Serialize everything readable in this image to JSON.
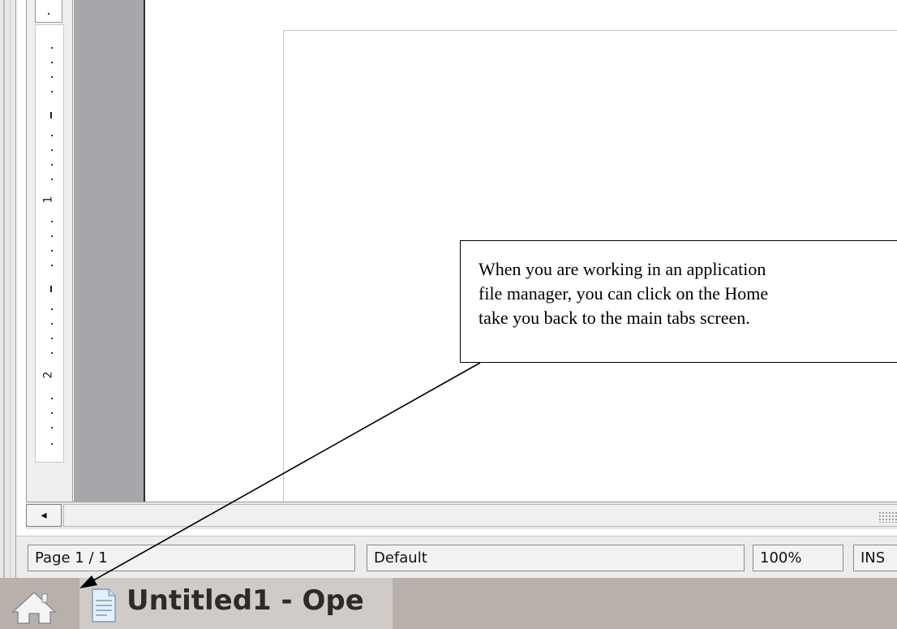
{
  "ruler": {
    "labels": [
      "1",
      "2"
    ]
  },
  "scrollbar": {
    "left_arrow": "◂"
  },
  "statusbar": {
    "page": "Page 1 / 1",
    "style": "Default",
    "zoom": "100%",
    "mode": "INS"
  },
  "taskbar": {
    "home_icon": "home-icon",
    "window_icon": "document-icon",
    "window_title": "Untitled1 - Ope"
  },
  "callout": {
    "lines": [
      "When you are working in an application",
      "file manager, you can click on the Home",
      "take you back to the main tabs screen."
    ]
  }
}
